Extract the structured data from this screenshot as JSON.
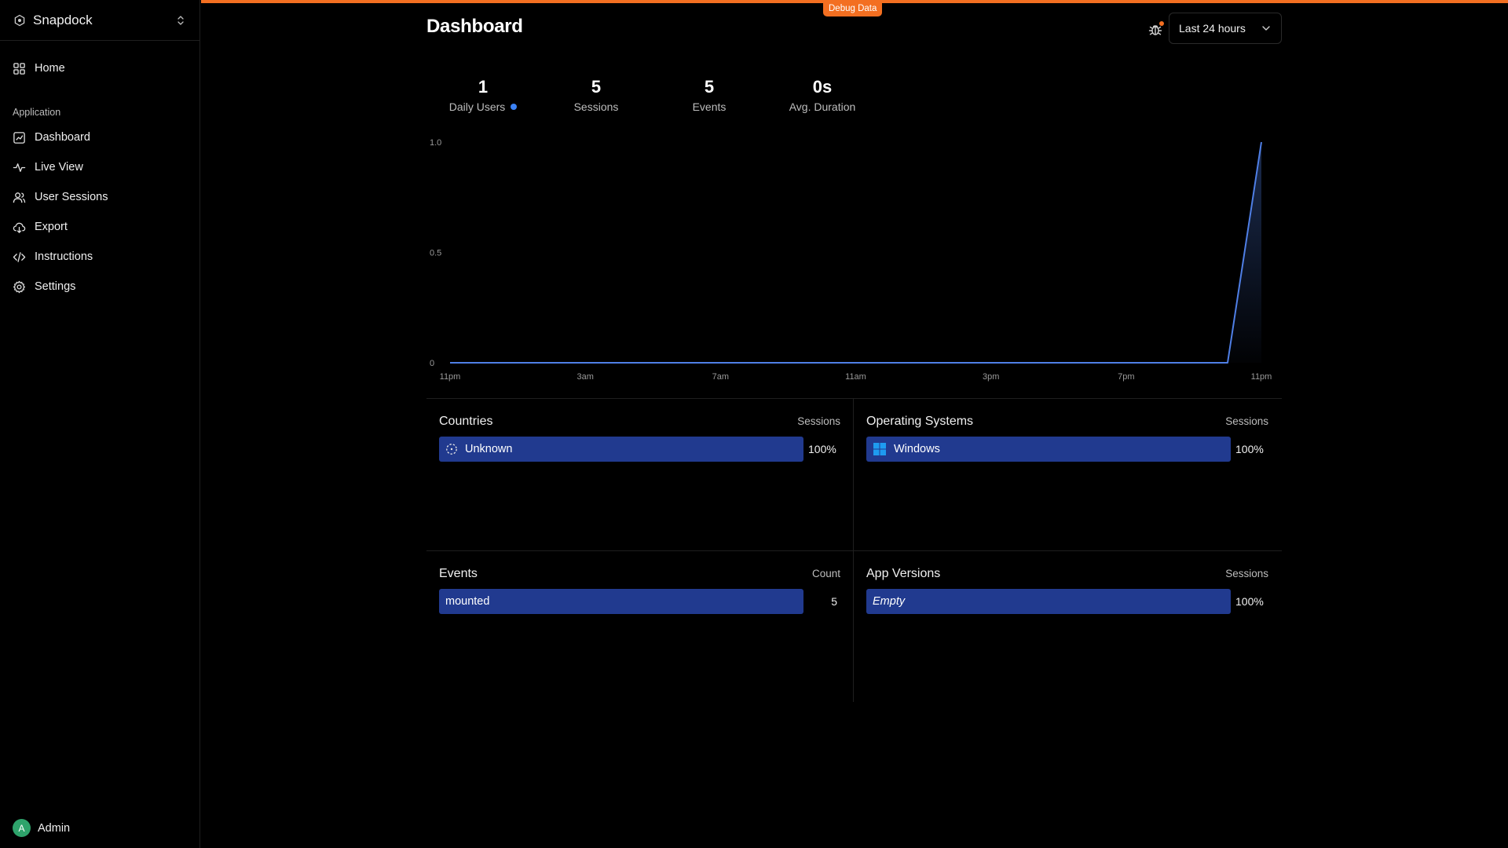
{
  "sidebar": {
    "org_name": "Snapdock",
    "nav_home": "Home",
    "group_label": "Application",
    "items": [
      {
        "label": "Dashboard",
        "icon": "chart-icon"
      },
      {
        "label": "Live View",
        "icon": "pulse-icon"
      },
      {
        "label": "User Sessions",
        "icon": "users-icon"
      },
      {
        "label": "Export",
        "icon": "cloud-download-icon"
      },
      {
        "label": "Instructions",
        "icon": "code-icon"
      },
      {
        "label": "Settings",
        "icon": "gear-icon"
      }
    ],
    "user": {
      "initial": "A",
      "name": "Admin"
    }
  },
  "debug": {
    "label": "Debug Data",
    "accent": "#f36f21"
  },
  "header": {
    "title": "Dashboard",
    "range": "Last 24 hours"
  },
  "stats": [
    {
      "value": "1",
      "label": "Daily Users"
    },
    {
      "value": "5",
      "label": "Sessions"
    },
    {
      "value": "5",
      "label": "Events"
    },
    {
      "value": "0s",
      "label": "Avg. Duration"
    }
  ],
  "chart_data": {
    "type": "area",
    "x_tick_labels": [
      "11pm",
      "3am",
      "7am",
      "11am",
      "3pm",
      "7pm",
      "11pm"
    ],
    "y_tick_labels": [
      "0",
      "0.5",
      "1.0"
    ],
    "ylim": [
      0,
      1
    ],
    "x_hours": [
      0,
      1,
      2,
      3,
      4,
      5,
      6,
      7,
      8,
      9,
      10,
      11,
      12,
      13,
      14,
      15,
      16,
      17,
      18,
      19,
      20,
      21,
      22,
      23,
      24
    ],
    "values": [
      0,
      0,
      0,
      0,
      0,
      0,
      0,
      0,
      0,
      0,
      0,
      0,
      0,
      0,
      0,
      0,
      0,
      0,
      0,
      0,
      0,
      0,
      0,
      0,
      1
    ],
    "color": "#4f7fe6"
  },
  "panels": {
    "countries": {
      "title": "Countries",
      "col": "Sessions",
      "rows": [
        {
          "label": "Unknown",
          "value": "100%"
        }
      ]
    },
    "os": {
      "title": "Operating Systems",
      "col": "Sessions",
      "rows": [
        {
          "label": "Windows",
          "value": "100%"
        }
      ]
    },
    "events": {
      "title": "Events",
      "col": "Count",
      "rows": [
        {
          "label": "mounted",
          "value": "5"
        }
      ]
    },
    "versions": {
      "title": "App Versions",
      "col": "Sessions",
      "rows": [
        {
          "label": "Empty",
          "value": "100%"
        }
      ]
    }
  },
  "colors": {
    "bar": "#213a8f",
    "avatar": "#2ea36b",
    "live_dot": "#3b82f6"
  }
}
